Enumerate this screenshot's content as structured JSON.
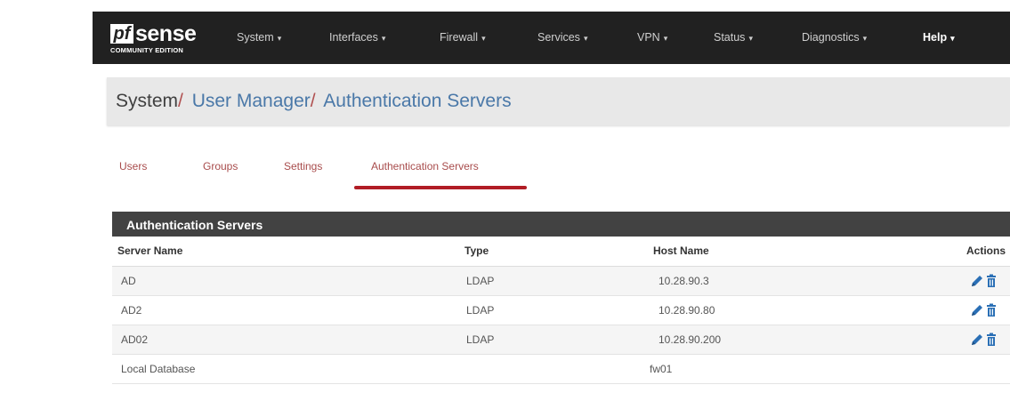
{
  "navbar": {
    "logo": {
      "mark": "pf",
      "text": "sense",
      "subtitle": "COMMUNITY EDITION"
    },
    "items": [
      {
        "label": "System"
      },
      {
        "label": "Interfaces"
      },
      {
        "label": "Firewall"
      },
      {
        "label": "Services"
      },
      {
        "label": "VPN"
      },
      {
        "label": "Status"
      },
      {
        "label": "Diagnostics"
      },
      {
        "label": "Help"
      }
    ],
    "caret": "▾"
  },
  "breadcrumb": {
    "root": "System",
    "sep": "/",
    "level2": "User Manager",
    "level3": "Authentication Servers"
  },
  "tabs": [
    {
      "label": "Users"
    },
    {
      "label": "Groups"
    },
    {
      "label": "Settings"
    },
    {
      "label": "Authentication Servers",
      "active": true
    }
  ],
  "panel": {
    "title": "Authentication Servers",
    "columns": [
      "Server Name",
      "Type",
      "Host Name",
      "Actions"
    ],
    "rows": [
      {
        "name": "AD",
        "type": "LDAP",
        "host": "10.28.90.3",
        "actions": true
      },
      {
        "name": "AD2",
        "type": "LDAP",
        "host": "10.28.90.80",
        "actions": true
      },
      {
        "name": "AD02",
        "type": "LDAP",
        "host": "10.28.90.200",
        "actions": true
      },
      {
        "name": "Local Database",
        "type": "",
        "host": "fw01",
        "actions": false
      }
    ]
  },
  "icons": {
    "edit": "pencil-icon",
    "delete": "trash-icon"
  },
  "colors": {
    "navbar": "#212121",
    "link": "#4a78a8",
    "tab": "#a84c4c",
    "tab_active_bar": "#b11d25",
    "panel_heading": "#424242",
    "action_icon": "#2a6fb5"
  }
}
